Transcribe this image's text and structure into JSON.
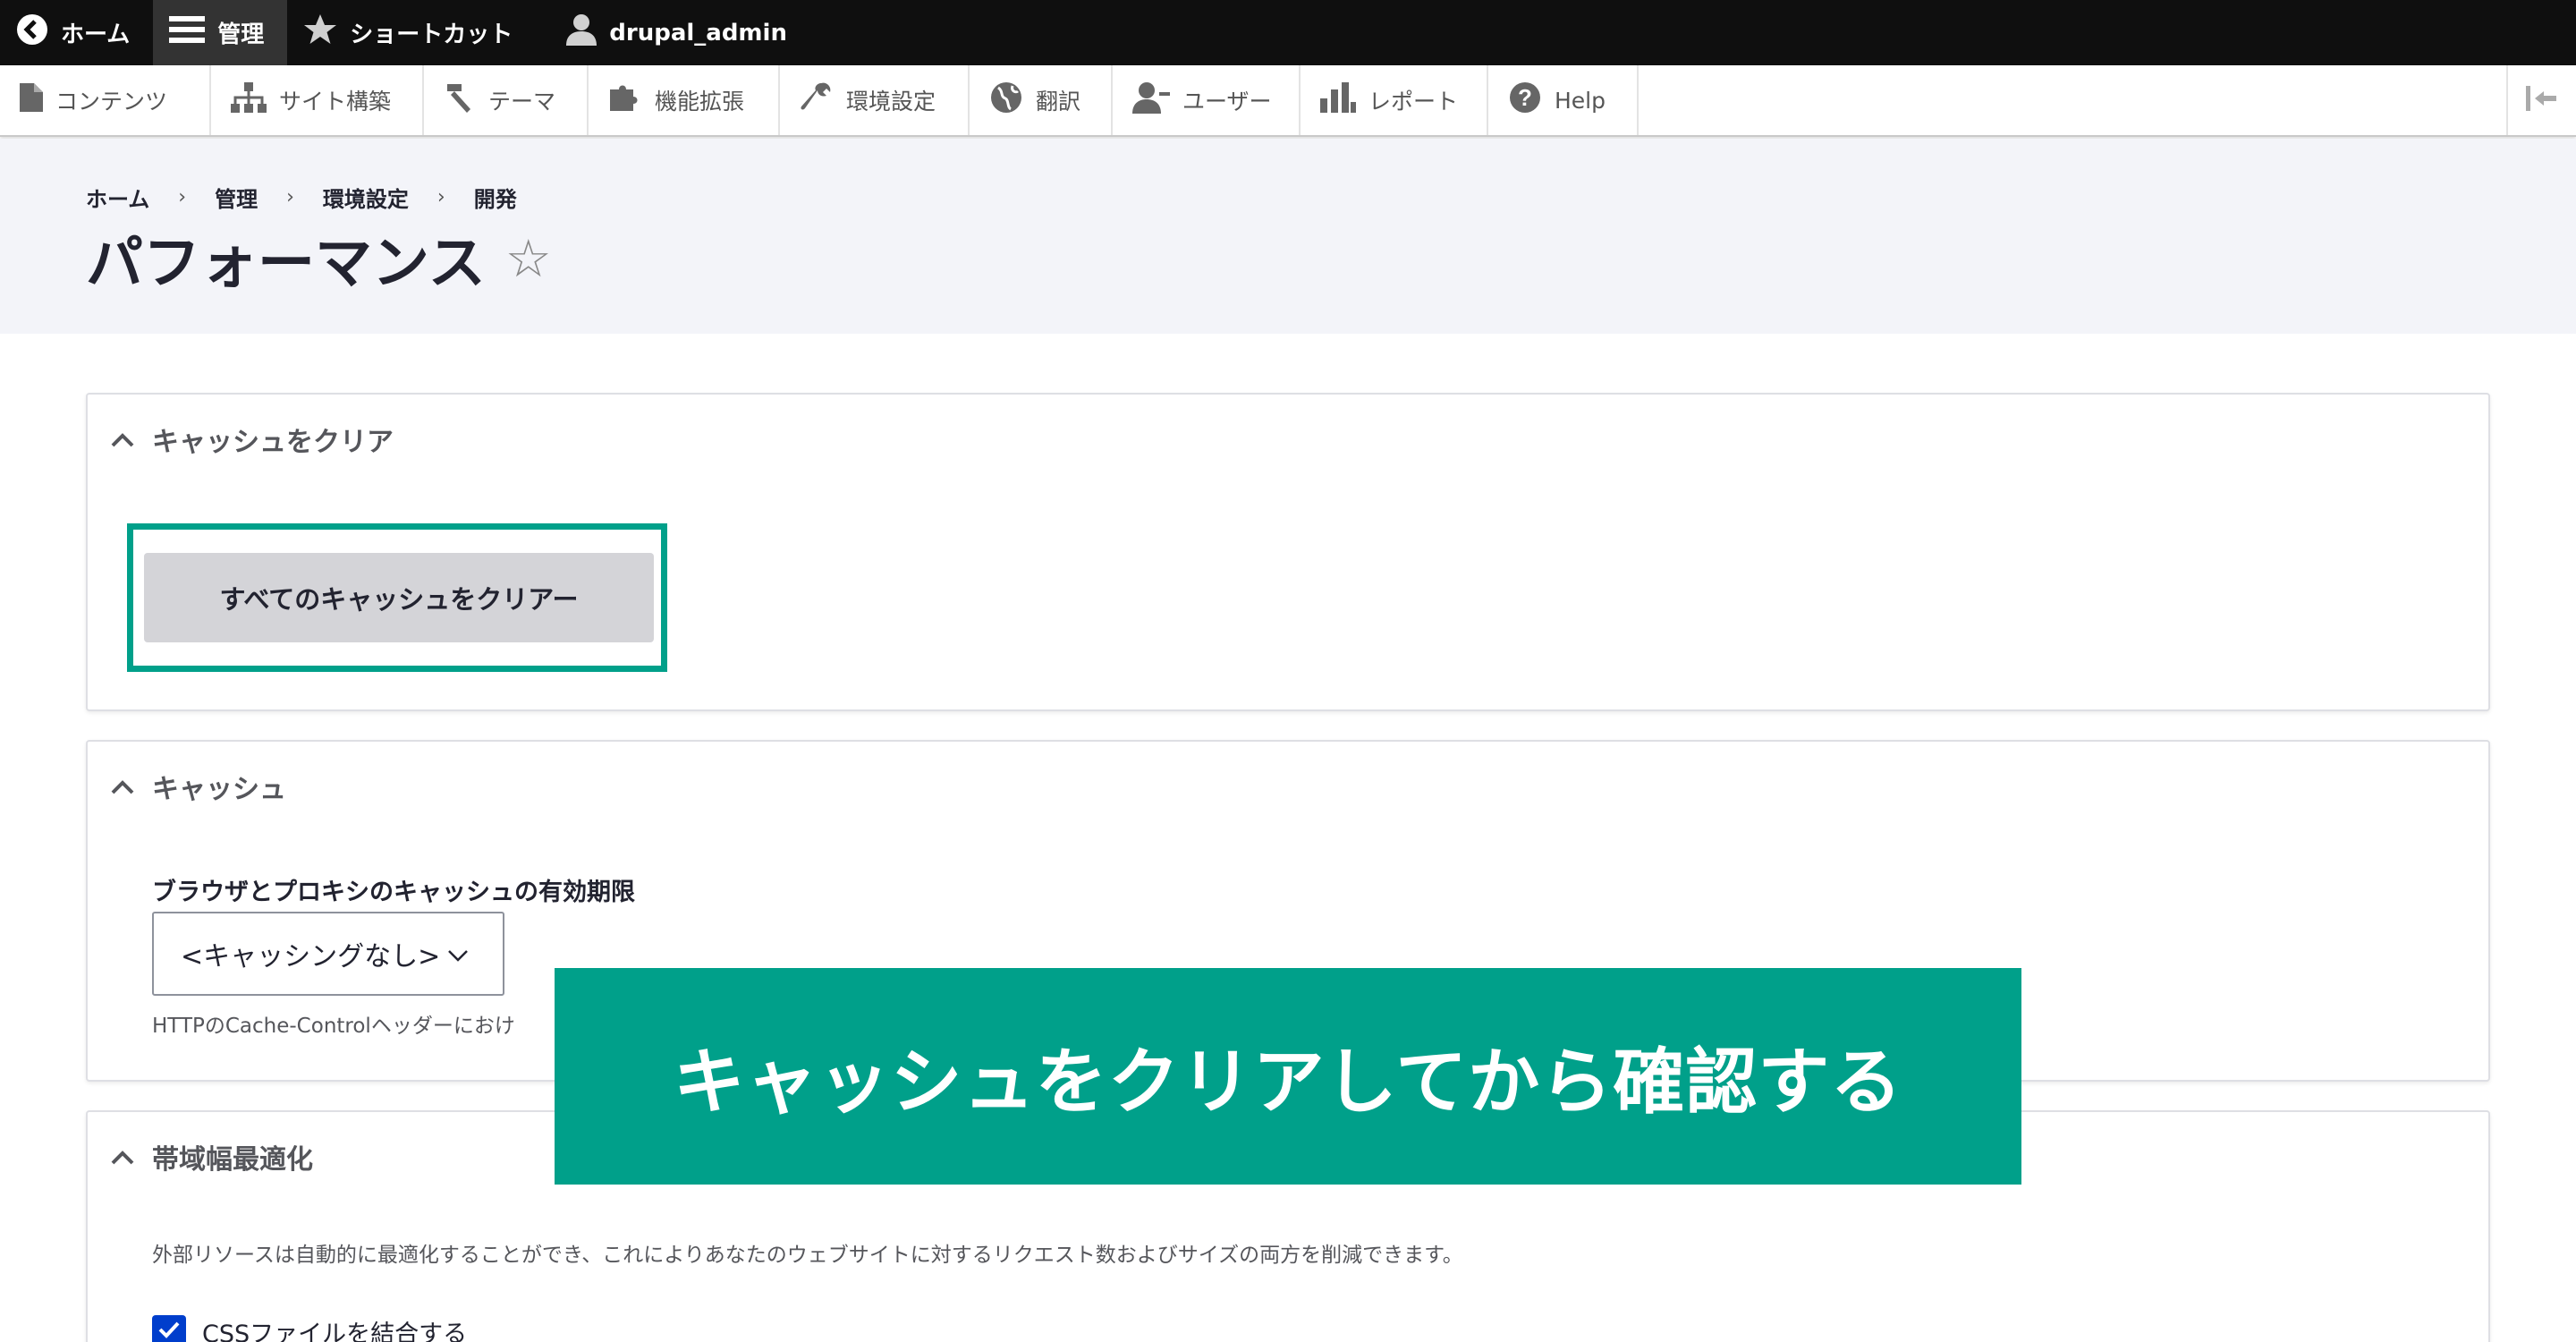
{
  "toolbar": {
    "back_icon": "chevron-left-circle-icon",
    "home_label": "ホーム",
    "manage_label": "管理",
    "shortcuts_label": "ショートカット",
    "user_label": "drupal_admin"
  },
  "tray": {
    "items": [
      {
        "label": "コンテンツ",
        "icon": "file-icon"
      },
      {
        "label": "サイト構築",
        "icon": "sitemap-icon"
      },
      {
        "label": "テーマ",
        "icon": "paintbrush-icon"
      },
      {
        "label": "機能拡張",
        "icon": "puzzle-icon"
      },
      {
        "label": "環境設定",
        "icon": "wrench-icon"
      },
      {
        "label": "翻訳",
        "icon": "globe-icon"
      },
      {
        "label": "ユーザー",
        "icon": "people-icon"
      },
      {
        "label": "レポート",
        "icon": "bar-chart-icon"
      },
      {
        "label": "Help",
        "icon": "question-icon"
      }
    ]
  },
  "breadcrumb": [
    "ホーム",
    "管理",
    "環境設定",
    "開発"
  ],
  "page_title": "パフォーマンス",
  "clear_cache": {
    "heading": "キャッシュをクリア",
    "button_label": "すべてのキャッシュをクリアー"
  },
  "caching": {
    "heading": "キャッシュ",
    "field_label": "ブラウザとプロキシのキャッシュの有効期限",
    "select_value": "<キャッシングなし>",
    "help_text": "HTTPのCache-Controlヘッダーにおけ"
  },
  "bandwidth": {
    "heading": "帯域幅最適化",
    "description": "外部リソースは自動的に最適化することができ、これによりあなたのウェブサイトに対するリクエスト数およびサイズの両方を削減できます。",
    "checkbox_label": "CSSファイルを結合する",
    "checkbox_checked": true
  },
  "banner_text": "キャッシュをクリアしてから確認する",
  "colors": {
    "accent": "#00a08a",
    "toolbar_bg": "#0f0f0f",
    "checkbox": "#003ecc"
  }
}
